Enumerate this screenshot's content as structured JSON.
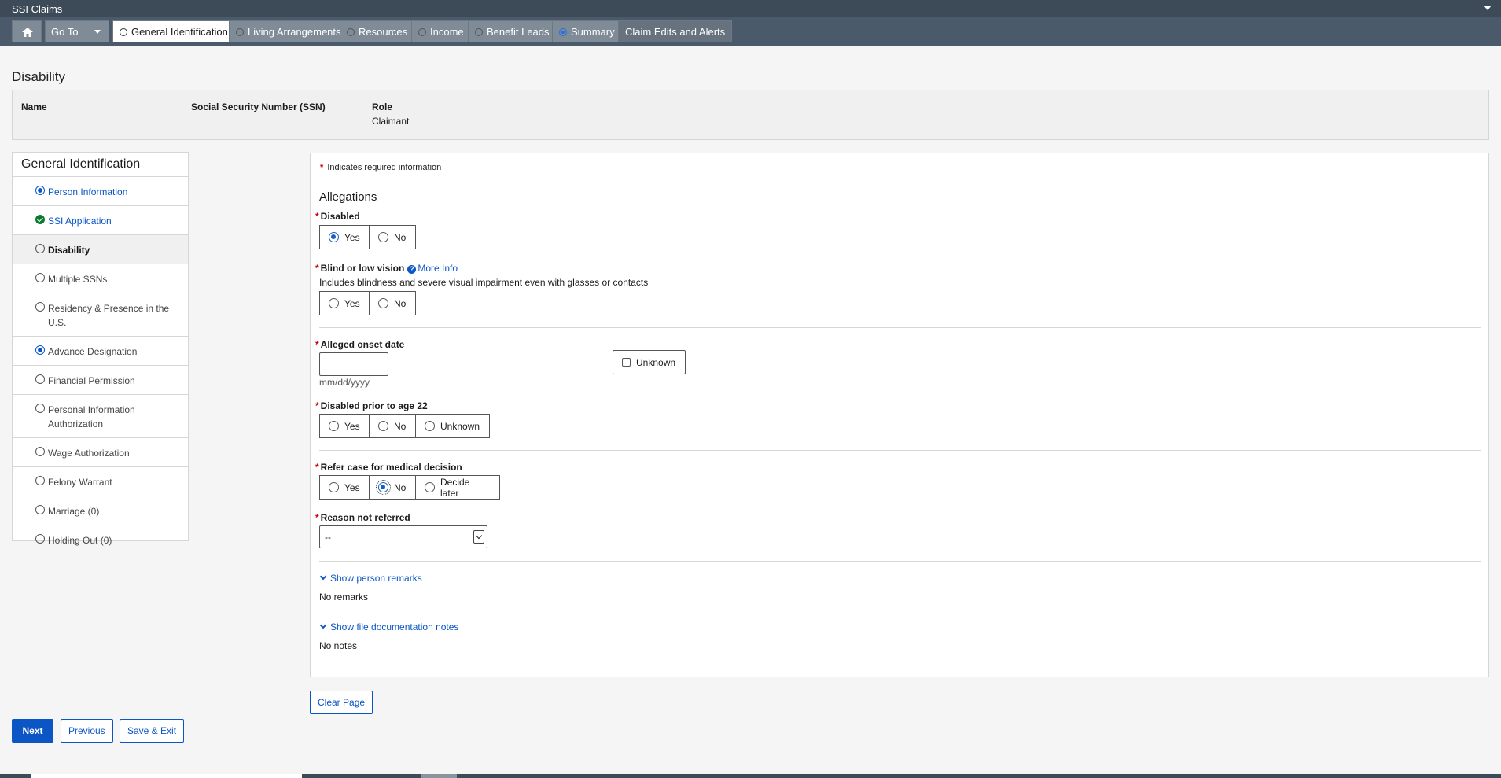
{
  "app": {
    "title": "SSI Claims"
  },
  "tabs": {
    "goto_label": "Go To",
    "items": [
      {
        "label": "General Identification"
      },
      {
        "label": "Living Arrangements"
      },
      {
        "label": "Resources"
      },
      {
        "label": "Income"
      },
      {
        "label": "Benefit Leads"
      },
      {
        "label": "Summary"
      },
      {
        "label": "Claim Edits and Alerts"
      }
    ]
  },
  "page": {
    "title": "Disability"
  },
  "header": {
    "name_label": "Name",
    "ssn_label": "Social Security Number (SSN)",
    "role_label": "Role",
    "role_value": "Claimant"
  },
  "sidebar": {
    "title": "General Identification",
    "items": [
      {
        "label": "Person Information",
        "status": "in-progress"
      },
      {
        "label": "SSI Application",
        "status": "complete"
      },
      {
        "label": "Disability",
        "status": "current"
      },
      {
        "label": "Multiple SSNs",
        "status": "not-started"
      },
      {
        "label": "Residency & Presence in the U.S.",
        "status": "not-started"
      },
      {
        "label": "Advance Designation",
        "status": "in-progress"
      },
      {
        "label": "Financial Permission",
        "status": "not-started"
      },
      {
        "label": "Personal Information Authorization",
        "status": "not-started"
      },
      {
        "label": "Wage Authorization",
        "status": "not-started"
      },
      {
        "label": "Felony Warrant",
        "status": "not-started"
      },
      {
        "label": "Marriage (0)",
        "status": "not-started"
      },
      {
        "label": "Holding Out (0)",
        "status": "not-started"
      }
    ]
  },
  "form": {
    "required_note": "Indicates required information",
    "section_title": "Allegations",
    "disabled": {
      "label": "Disabled",
      "yes": "Yes",
      "no": "No",
      "selected": "Yes"
    },
    "blind": {
      "label": "Blind or low vision",
      "more_info": "More Info",
      "help": "Includes blindness and severe visual impairment even with glasses or contacts",
      "yes": "Yes",
      "no": "No",
      "selected": ""
    },
    "onset": {
      "label": "Alleged onset date",
      "value": "",
      "hint": "mm/dd/yyyy",
      "unknown_label": "Unknown"
    },
    "prior22": {
      "label": "Disabled prior to age 22",
      "yes": "Yes",
      "no": "No",
      "unknown": "Unknown",
      "selected": ""
    },
    "refer": {
      "label": "Refer case for medical decision",
      "yes": "Yes",
      "no": "No",
      "later": "Decide later",
      "selected": "No"
    },
    "reason": {
      "label": "Reason not referred",
      "value": "--"
    },
    "person_remarks": {
      "toggle": "Show person remarks",
      "text": "No remarks"
    },
    "file_notes": {
      "toggle": "Show file documentation notes",
      "text": "No notes"
    }
  },
  "actions": {
    "clear": "Clear Page",
    "next": "Next",
    "previous": "Previous",
    "save_exit": "Save & Exit"
  }
}
